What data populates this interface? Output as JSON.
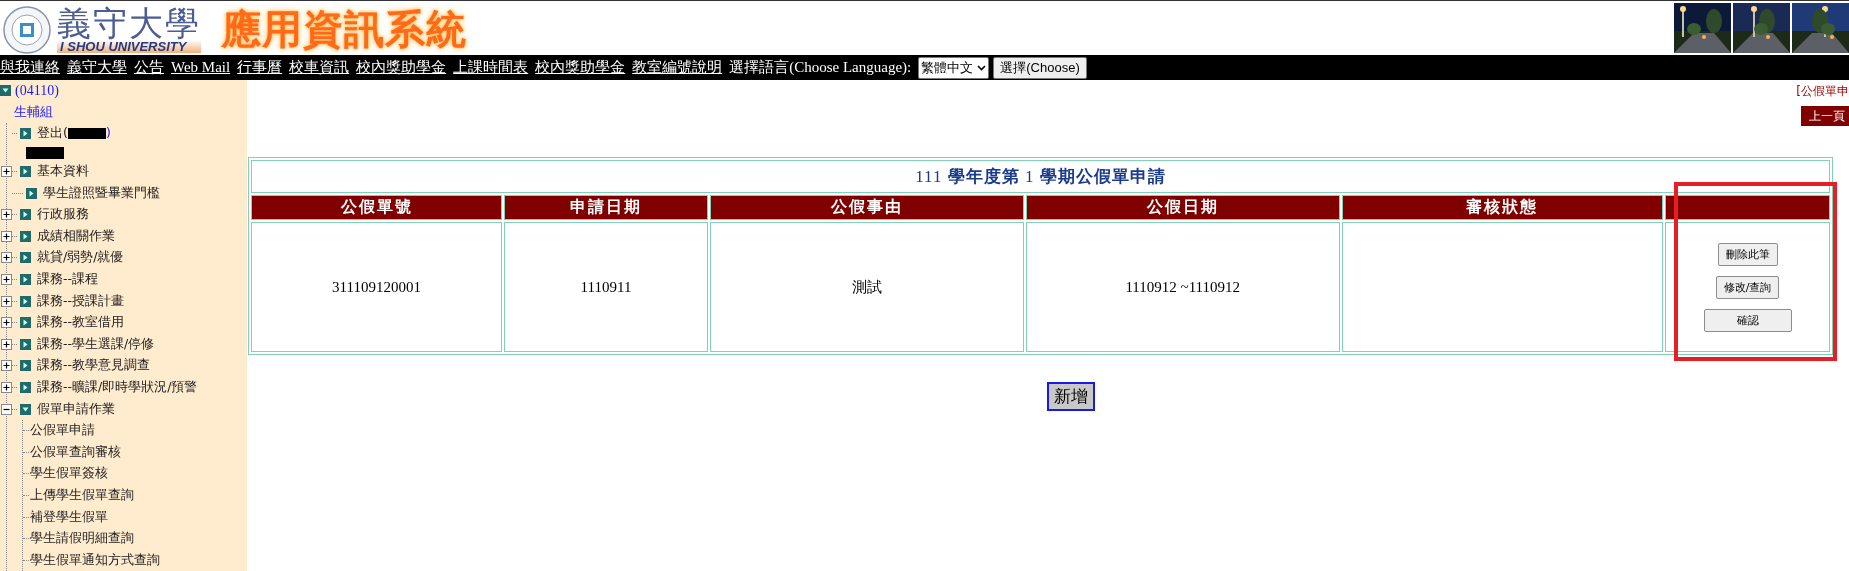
{
  "header": {
    "school_name": "義守大學",
    "school_english": "I SHOU UNIVERSITY",
    "system_title": "應用資訊系統"
  },
  "nav": {
    "links": [
      "與我連絡",
      "義守大學",
      "公告",
      "Web Mail",
      "行事曆",
      "校車資訊",
      "校內獎助學金",
      "上課時間表",
      "校內獎助學金",
      "教室編號說明"
    ],
    "language_label": "選擇語言(Choose Language):",
    "language_select": "繁體中文",
    "choose_button": "選擇(Choose)"
  },
  "sidebar": {
    "root": {
      "code": "(04110)",
      "unit": "生輔組",
      "expanded": true
    },
    "items": [
      {
        "kind": "logout",
        "label": "登出(",
        "label_end": ")"
      },
      {
        "kind": "redacted"
      },
      {
        "kind": "folder",
        "label": "基本資料",
        "expanded": false
      },
      {
        "kind": "link",
        "label": "學生證照暨畢業門檻"
      },
      {
        "kind": "folder",
        "label": "行政服務",
        "expanded": false
      },
      {
        "kind": "folder",
        "label": "成績相關作業",
        "expanded": false
      },
      {
        "kind": "folder",
        "label": "就貸/弱勢/就優",
        "expanded": false
      },
      {
        "kind": "folder",
        "label": "課務--課程",
        "expanded": false
      },
      {
        "kind": "folder",
        "label": "課務--授課計畫",
        "expanded": false
      },
      {
        "kind": "folder",
        "label": "課務--教室借用",
        "expanded": false
      },
      {
        "kind": "folder",
        "label": "課務--學生選課/停修",
        "expanded": false
      },
      {
        "kind": "folder",
        "label": "課務--教學意見調查",
        "expanded": false
      },
      {
        "kind": "folder",
        "label": "課務--曠課/即時學狀況/預警",
        "expanded": false
      },
      {
        "kind": "folder",
        "label": "假單申請作業",
        "expanded": true,
        "children": [
          "公假單申請",
          "公假單查詢審核",
          "學生假單簽核",
          "上傳學生假單查詢",
          "補登學生假單",
          "學生請假明細查詢",
          "學生假單通知方式查詢"
        ]
      }
    ]
  },
  "main": {
    "breadcrumb": "[公假單申",
    "back_button": "上一頁",
    "table": {
      "title": "111 **學年度第** 1 **學期公假單申請**",
      "columns": [
        "公假單號",
        "申請日期",
        "公假事由",
        "公假日期",
        "審核狀態"
      ],
      "rows": [
        {
          "cells": [
            "311109120001",
            "1110911",
            "測試",
            "1110912 ~1110912",
            ""
          ],
          "actions": [
            "刪除此筆",
            "修改/查詢",
            "確認"
          ]
        }
      ]
    },
    "add_button": "新增"
  }
}
